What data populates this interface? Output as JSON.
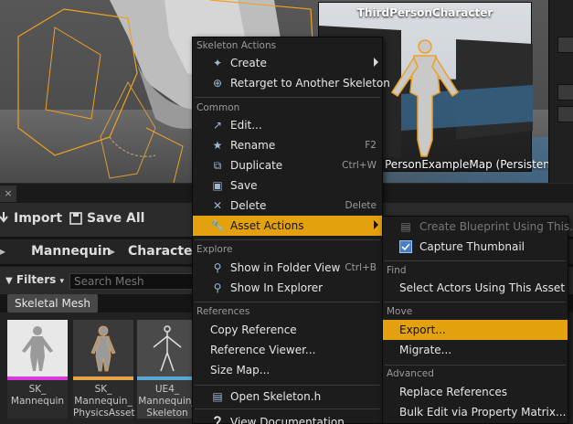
{
  "viewport": {
    "thumbnail_title": "ThirdPersonCharacter",
    "thumbnail_subtitle": "PersonExampleMap (Persistent)"
  },
  "tab_strip": {
    "close_label": "×"
  },
  "toolbar": {
    "import_label": "Import",
    "save_all_label": "Save All"
  },
  "breadcrumb": {
    "items": [
      "Mannequin",
      "Character"
    ]
  },
  "filter": {
    "filters_label": "Filters",
    "search_placeholder": "Search Mesh",
    "active_filter": "Skeletal Mesh"
  },
  "assets": [
    {
      "name": "SK_\nMannequin",
      "color": "#d83adb"
    },
    {
      "name": "SK_\nMannequin_\nPhysicsAsset",
      "color": "#e6a24a"
    },
    {
      "name": "UE4_\nMannequin_\nSkeleton",
      "color": "#5aa8d8"
    }
  ],
  "context_menu": {
    "sections": [
      {
        "header": "Skeleton Actions",
        "items": [
          {
            "label": "Create",
            "icon": "create-icon",
            "submenu": true
          },
          {
            "label": "Retarget to Another Skeleton",
            "icon": "retarget-icon"
          }
        ]
      },
      {
        "header": "Common",
        "items": [
          {
            "label": "Edit...",
            "icon": "edit-icon"
          },
          {
            "label": "Rename",
            "icon": "rename-icon",
            "shortcut": "F2"
          },
          {
            "label": "Duplicate",
            "icon": "duplicate-icon",
            "shortcut": "Ctrl+W"
          },
          {
            "label": "Save",
            "icon": "save-icon"
          },
          {
            "label": "Delete",
            "icon": "delete-icon",
            "shortcut": "Delete"
          },
          {
            "label": "Asset Actions",
            "icon": "asset-actions-icon",
            "submenu": true,
            "highlighted": true
          }
        ]
      },
      {
        "header": "Explore",
        "items": [
          {
            "label": "Show in Folder View",
            "icon": "folder-view-icon",
            "shortcut": "Ctrl+B"
          },
          {
            "label": "Show In Explorer",
            "icon": "explorer-icon"
          }
        ]
      },
      {
        "header": "References",
        "items": [
          {
            "label": "Copy Reference"
          },
          {
            "label": "Reference Viewer..."
          },
          {
            "label": "Size Map..."
          }
        ]
      },
      {
        "header": "",
        "items": [
          {
            "label": "Open Skeleton.h",
            "icon": "header-file-icon"
          },
          {
            "label": "View Documentation",
            "icon": "documentation-icon"
          }
        ]
      }
    ]
  },
  "submenu": {
    "items": [
      {
        "label": "Create Blueprint Using This...",
        "icon": "blueprint-icon",
        "disabled": true
      },
      {
        "label": "Capture Thumbnail",
        "icon": "capture-thumbnail-icon"
      }
    ],
    "find_header": "Find",
    "find_items": [
      {
        "label": "Select Actors Using This Asset"
      }
    ],
    "move_header": "Move",
    "move_items": [
      {
        "label": "Export...",
        "highlighted": true
      },
      {
        "label": "Migrate..."
      }
    ],
    "advanced_header": "Advanced",
    "advanced_items": [
      {
        "label": "Replace References"
      },
      {
        "label": "Bulk Edit via Property Matrix..."
      }
    ]
  },
  "colors": {
    "accent": "#e2a10d",
    "menu_bg": "#1c1c1c",
    "selection_outline": "#f0a020"
  }
}
